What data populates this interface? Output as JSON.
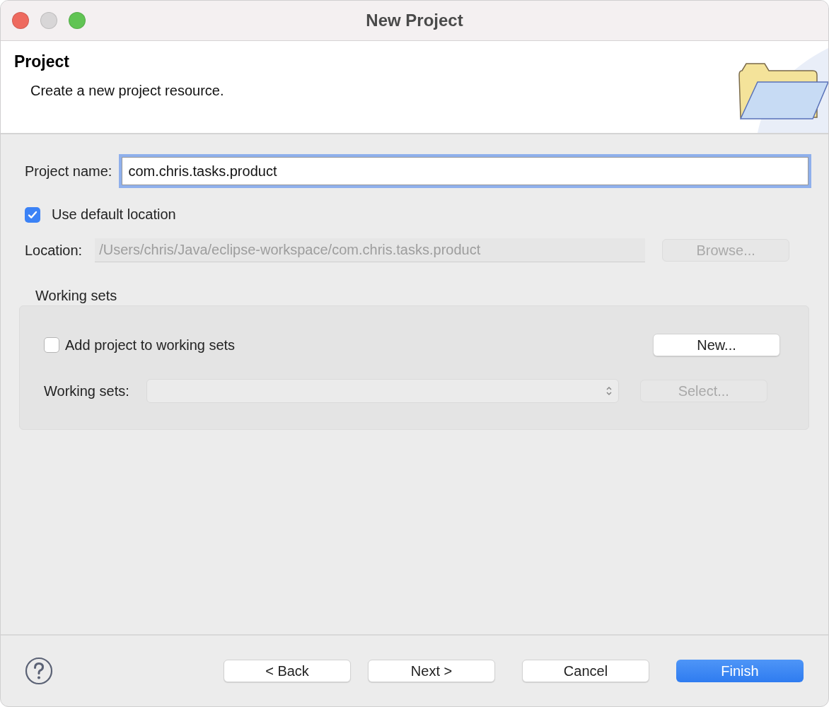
{
  "window": {
    "title": "New Project"
  },
  "header": {
    "title": "Project",
    "description": "Create a new project resource."
  },
  "project_name": {
    "label": "Project name:",
    "value": "com.chris.tasks.product",
    "focused": true
  },
  "use_default_location": {
    "label": "Use default location",
    "checked": true
  },
  "location": {
    "label": "Location:",
    "value": "/Users/chris/Java/eclipse-workspace/com.chris.tasks.product",
    "disabled": true,
    "button": {
      "label": "Browse...",
      "disabled": true
    }
  },
  "working_sets": {
    "title": "Working sets",
    "add": {
      "label": "Add project to working sets",
      "checked": false
    },
    "new_button": {
      "label": "New...",
      "disabled": false
    },
    "select_label": "Working sets:",
    "select": {
      "disabled": true
    },
    "select_button": {
      "label": "Select...",
      "disabled": true
    }
  },
  "footer": {
    "buttons": [
      {
        "label": "< Back",
        "kind": "default"
      },
      {
        "label": "Next >",
        "kind": "default"
      },
      {
        "label": "Cancel",
        "kind": "default"
      },
      {
        "label": "Finish",
        "kind": "primary"
      }
    ]
  }
}
